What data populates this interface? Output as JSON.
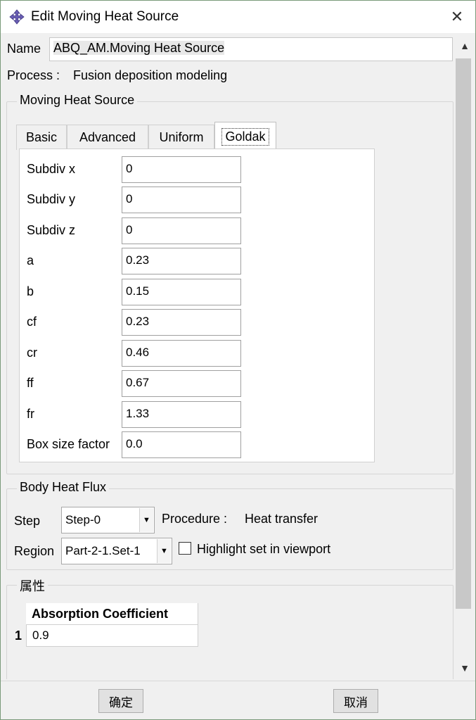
{
  "window": {
    "title": "Edit Moving Heat Source",
    "close": "✕"
  },
  "name": {
    "label": "Name",
    "value": "ABQ_AM.Moving Heat Source"
  },
  "process": {
    "label": "Process :",
    "value": "Fusion deposition modeling"
  },
  "moving_heat_source": {
    "group_title": "Moving Heat Source",
    "tabs": [
      {
        "label": "Basic"
      },
      {
        "label": "Advanced"
      },
      {
        "label": "Uniform"
      },
      {
        "label": "Goldak",
        "active": true
      }
    ],
    "fields": [
      {
        "label": "Subdiv x",
        "value": "0"
      },
      {
        "label": "Subdiv y",
        "value": "0"
      },
      {
        "label": "Subdiv z",
        "value": "0"
      },
      {
        "label": "a",
        "value": "0.23"
      },
      {
        "label": "b",
        "value": "0.15"
      },
      {
        "label": "cf",
        "value": "0.23"
      },
      {
        "label": "cr",
        "value": "0.46"
      },
      {
        "label": "ff",
        "value": "0.67"
      },
      {
        "label": "fr",
        "value": "1.33"
      },
      {
        "label": "Box size factor",
        "value": "0.0"
      }
    ]
  },
  "body_heat_flux": {
    "group_title": "Body Heat Flux",
    "step_label": "Step",
    "step_value": "Step-0",
    "procedure_label": "Procedure :",
    "procedure_value": "Heat transfer",
    "region_label": "Region",
    "region_value": "Part-2-1.Set-1",
    "highlight_label": "Highlight set in viewport",
    "highlight_checked": false
  },
  "properties": {
    "group_title": "属性",
    "column_header": "Absorption Coefficient",
    "rows": [
      {
        "index": "1",
        "value": "0.9"
      }
    ]
  },
  "buttons": {
    "ok": "确定",
    "cancel": "取消"
  },
  "scrollbar": {
    "up": "▲",
    "down": "▼"
  }
}
